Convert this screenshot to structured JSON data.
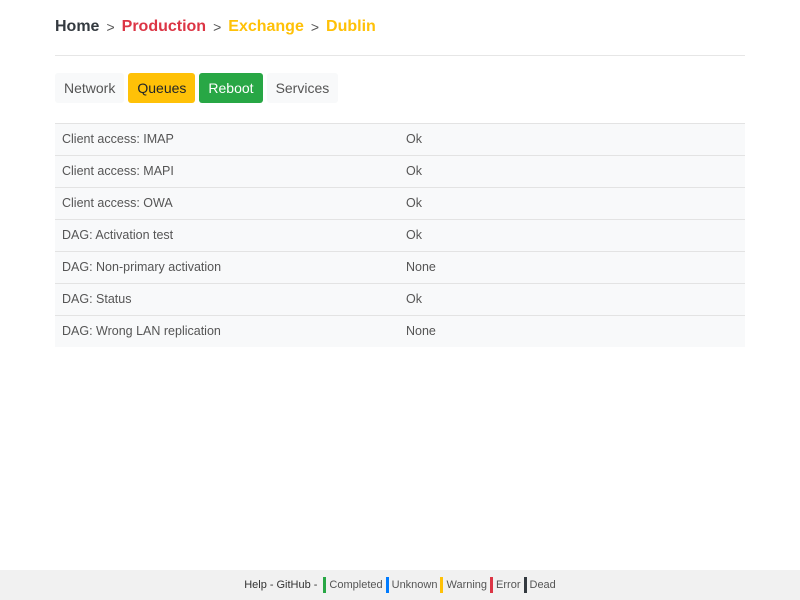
{
  "breadcrumb": {
    "items": [
      {
        "label": "Home",
        "color": "#343a40"
      },
      {
        "label": "Production",
        "color": "#dc3545"
      },
      {
        "label": "Exchange",
        "color": "#ffc107"
      },
      {
        "label": "Dublin",
        "color": "#ffc107"
      }
    ],
    "separator": ">"
  },
  "tabs": [
    {
      "label": "Network"
    },
    {
      "label": "Queues",
      "color": "#ffc107"
    },
    {
      "label": "Reboot",
      "color": "#28a745"
    },
    {
      "label": "Services"
    }
  ],
  "checks": [
    {
      "name": "Client access: IMAP",
      "status": "Ok"
    },
    {
      "name": "Client access: MAPI",
      "status": "Ok"
    },
    {
      "name": "Client access: OWA",
      "status": "Ok"
    },
    {
      "name": "DAG: Activation test",
      "status": "Ok"
    },
    {
      "name": "DAG: Non-primary activation",
      "status": "None"
    },
    {
      "name": "DAG: Status",
      "status": "Ok"
    },
    {
      "name": "DAG: Wrong LAN replication",
      "status": "None"
    }
  ],
  "footer": {
    "help": "Help",
    "github": "GitHub",
    "separator": "-",
    "legend": [
      {
        "label": "Completed",
        "color": "#28a745"
      },
      {
        "label": "Unknown",
        "color": "#007bff"
      },
      {
        "label": "Warning",
        "color": "#ffc107"
      },
      {
        "label": "Error",
        "color": "#dc3545"
      },
      {
        "label": "Dead",
        "color": "#343a40"
      }
    ]
  }
}
